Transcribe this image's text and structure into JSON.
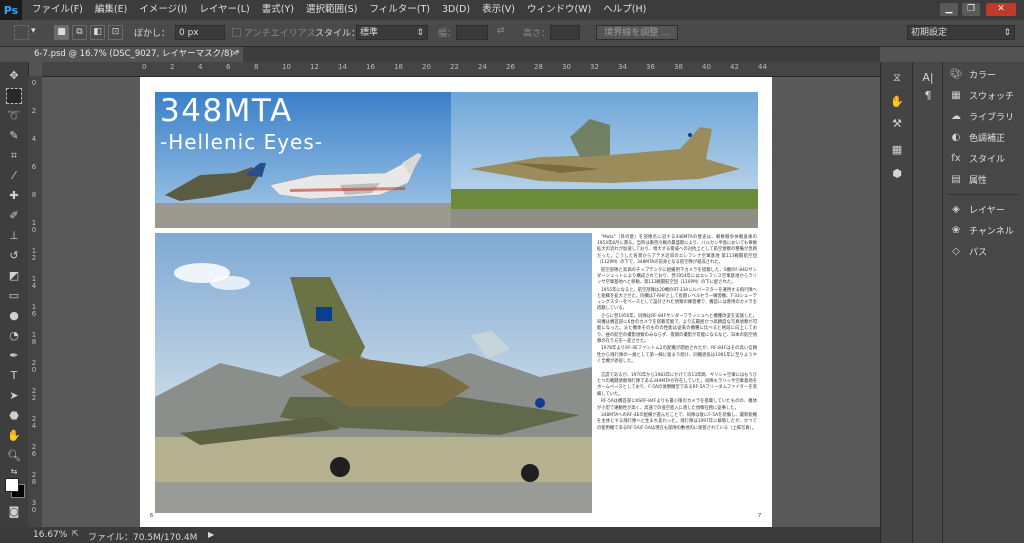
{
  "menubar": {
    "logo": "Ps",
    "items": [
      "ファイル(F)",
      "編集(E)",
      "イメージ(I)",
      "レイヤー(L)",
      "書式(Y)",
      "選択範囲(S)",
      "フィルター(T)",
      "3D(D)",
      "表示(V)",
      "ウィンドウ(W)",
      "ヘルプ(H)"
    ]
  },
  "options": {
    "feather_label": "ぼかし：",
    "feather_value": "0 px",
    "antialias_label": "アンチエイリアス",
    "style_label": "スタイル：",
    "style_value": "標準",
    "width_label": "幅：",
    "height_label": "高さ：",
    "refine_edge": "境界線を調整 ...",
    "workspace": "初期設定"
  },
  "document": {
    "tab_title": "6-7.psd @ 16.7% (DSC_9027, レイヤーマスク/8) *"
  },
  "status": {
    "zoom": "16.67%",
    "file_info": "ファイル：70.5M/170.4M"
  },
  "ruler": {
    "top": [
      "0",
      "2",
      "4",
      "6",
      "8",
      "10",
      "12",
      "14",
      "16",
      "18",
      "20",
      "22",
      "24",
      "26",
      "28",
      "30",
      "32",
      "34",
      "36",
      "38",
      "40",
      "42",
      "44"
    ],
    "left": [
      "0",
      "2",
      "4",
      "6",
      "8",
      "10",
      "12",
      "14",
      "16",
      "18",
      "20",
      "22",
      "24",
      "26",
      "28",
      "30"
    ]
  },
  "panels": {
    "items": [
      {
        "label": "カラー",
        "icon": "palette-icon"
      },
      {
        "label": "スウォッチ",
        "icon": "swatches-icon"
      },
      {
        "label": "ライブラリ",
        "icon": "library-icon"
      },
      {
        "label": "色調補正",
        "icon": "adjustments-icon"
      },
      {
        "label": "スタイル",
        "icon": "styles-icon"
      },
      {
        "label": "属性",
        "icon": "properties-icon"
      },
      {
        "label": "レイヤー",
        "icon": "layers-icon"
      },
      {
        "label": "チャンネル",
        "icon": "channels-icon"
      },
      {
        "label": "パス",
        "icon": "paths-icon"
      }
    ]
  },
  "magazine": {
    "title_line1": "348MTA",
    "title_line2": "-Hellenic Eyes-",
    "page_left": "6",
    "page_right": "7",
    "body": [
      "\"Mata\"（目の意）を部隊名に冠する348MTAの歴史は、朝鮮戦争休戦直後の1953年8月に遡る。当時は東西冷戦の最盛期により、バルカン半島においても華帳拡大の流れが加速しており、増大する脅威への対抗上として航空偵察の整備が急務だった。こうした背景からアテネ近郊のエレフシナ空軍基地 第113戦闘航空団（112PM）の下で、348MTAの前身となる航空隊が組成された。",
      "航空部隊と高価のチップテンタに組備用下カメラを搭載した、S機のF-84Gサンダージェットにより構成されており、翌1954年にはエレフシス空軍基地からラリッサ空軍基地へと移動、第113戦闘航空団（110PM）の下に配された。",
      "1955年になると、航空部隊は20機のRT-33Aシルバースターを運用する飛行隊へと組織を拡大させた。同機はT-RHFとして長期レベルセラー練習機、T-33シューティングスターをベースとして設計された偵察の練習機で、機首には専用のカメラを搭載している。",
      "さらに翌1956年、同隊はRF-84Fサンダーフラッシュへと機種改変を実施した。同機は機首部に6台のカメラを搭載可能で、より広範囲かつ高精度な写真偵察が可能になった。また機体そのものの性能は従来の機種に比べると格段に向上しており、昼の航空の撮影偵察のみならず、夜間の撮影が可能になるなど、日本の航空偵察の在り方を一変させた。",
      "1978年よりRF-4Eファントム2の配備が開始されたが、RF-84Fはその高い信頼性から飛行隊の一員として第一線に留まり続け、同機退役は1991年に至りようやく全機が退役した。",
      "言説であるが、1970年から1983年にかけての13年間、ギリシャ空軍にはもうひとつの戦闘偵察飛行隊である349MTAが存在していた。同隊もラリッサ空軍基地をホームベースとしており、F-5Aの偵察機型であるRF-5Aフリーダムファイターを装備していた。",
      "RF-5Aは機首部にKSRF-84Fよりも最小限のカメラを搭載していたものの、機体が小型で運動性が高く、高速での低空進入に適した偵察任務に従事した。",
      "348MTAへのRF-4Eの配備が進んだことで、同隊は後にF-5Aを装備し、最新鋭機を主体とする飛行隊へと生まれ変わった。飛行隊は1997年に解散したが、かつての使用機であるRF-5A/F-5Aは現在も部隊の敷地内に保管されている（上掲写真）。"
    ]
  }
}
